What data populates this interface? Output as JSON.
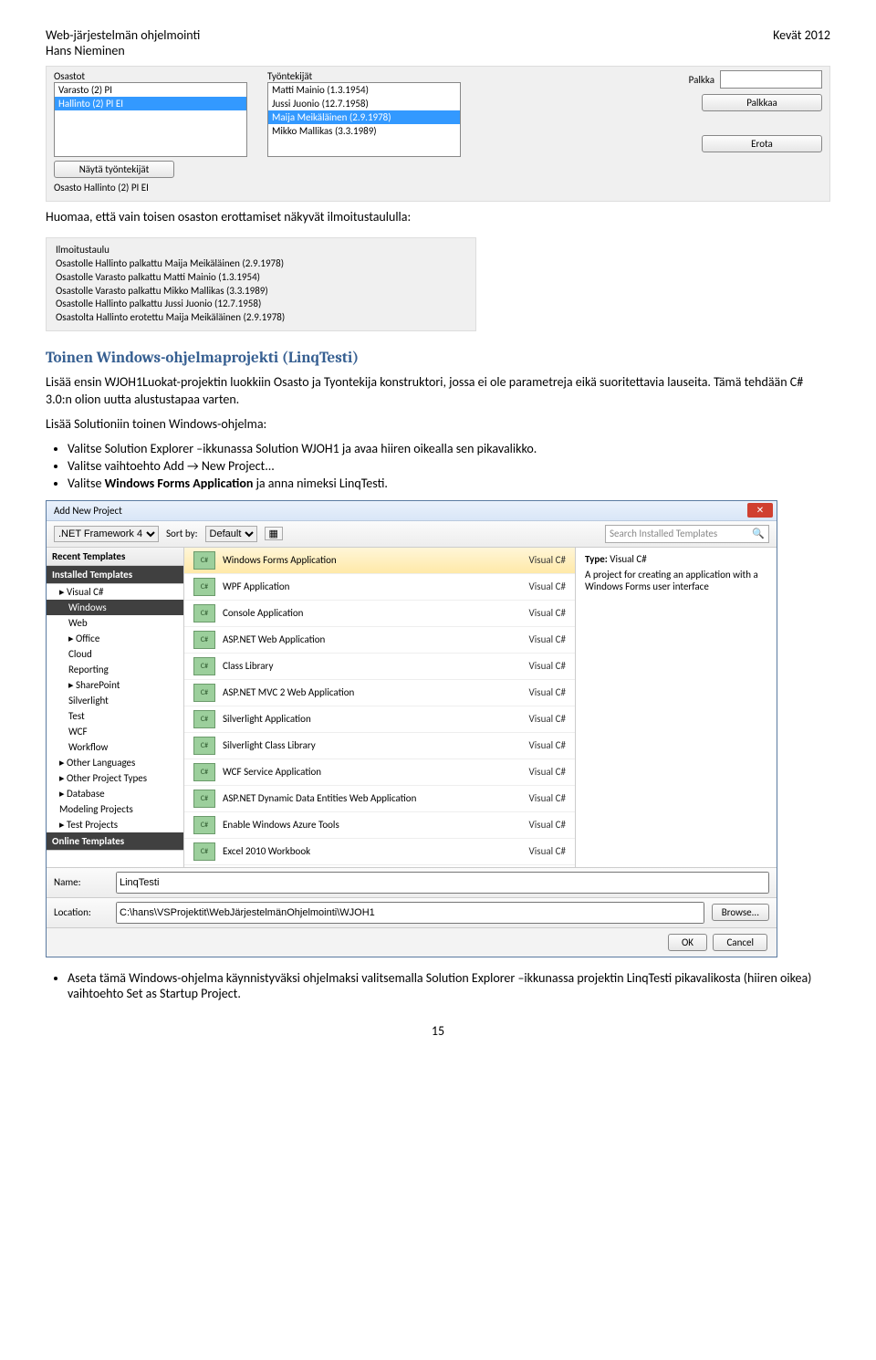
{
  "header": {
    "left1": "Web-järjestelmän ohjelmointi",
    "left2": "Hans Nieminen",
    "right": "Kevät 2012"
  },
  "formpanel": {
    "osastot_label": "Osastot",
    "osastot": [
      "Varasto (2) PI",
      "Hallinto (2) PI EI"
    ],
    "btn_nayta": "Näytä työntekijät",
    "summary": "Osasto Hallinto (2) PI EI",
    "tyontekijat_label": "Työntekijät",
    "tyontekijat": [
      "Matti Mainio (1.3.1954)",
      "Jussi Juonio (12.7.1958)",
      "Maija Meikäläinen (2.9.1978)",
      "Mikko Mallikas (3.3.1989)"
    ],
    "palkka_label": "Palkka",
    "btn_palkkaa": "Palkkaa",
    "btn_erota": "Erota"
  },
  "body_text1": "Huomaa, että vain toisen osaston erottamiset näkyvät ilmoitustaululla:",
  "ilmoituspanel": {
    "title": "Ilmoitustaulu",
    "rows": [
      "Osastolle Hallinto palkattu Maija Meikäläinen (2.9.1978)",
      "Osastolle Varasto palkattu Matti Mainio (1.3.1954)",
      "Osastolle Varasto palkattu Mikko Mallikas (3.3.1989)",
      "Osastolle Hallinto palkattu Jussi Juonio (12.7.1958)",
      "Osastolta Hallinto erotettu Maija Meikäläinen (2.9.1978)"
    ]
  },
  "h2": "Toinen Windows-ohjelmaprojekti (LinqTesti)",
  "p1": "Lisää ensin WJOH1Luokat-projektin luokkiin Osasto ja Tyontekija konstruktori, jossa ei ole parametreja eikä suoritettavia lauseita. Tämä tehdään C# 3.0:n olion uutta alustustapaa varten.",
  "p2": "Lisää Solutioniin toinen Windows-ohjelma:",
  "bullets_a": [
    "Valitse Solution Explorer –ikkunassa Solution WJOH1 ja avaa hiiren oikealla sen pikavalikko.",
    "Valitse vaihtoehto Add → New Project...",
    "Valitse <b>Windows Forms Application</b> ja anna nimeksi LinqTesti."
  ],
  "dialog": {
    "title": "Add New Project",
    "recent": "Recent Templates",
    "installed": "Installed Templates",
    "online": "Online Templates",
    "nav_root": "Visual C#",
    "nav_items": [
      "Windows",
      "Web",
      "Office",
      "Cloud",
      "Reporting",
      "SharePoint",
      "Silverlight",
      "Test",
      "WCF",
      "Workflow"
    ],
    "nav_after": [
      "Other Languages",
      "Other Project Types",
      "Database",
      "Modeling Projects",
      "Test Projects"
    ],
    "framework": ".NET Framework 4",
    "sortby": "Default",
    "search_placeholder": "Search Installed Templates",
    "lang": "Visual C#",
    "templates": [
      "Windows Forms Application",
      "WPF Application",
      "Console Application",
      "ASP.NET Web Application",
      "Class Library",
      "ASP.NET MVC 2 Web Application",
      "Silverlight Application",
      "Silverlight Class Library",
      "WCF Service Application",
      "ASP.NET Dynamic Data Entities Web Application",
      "Enable Windows Azure Tools",
      "Excel 2010 Workbook"
    ],
    "info_title": "Type:",
    "info_desc": "A project for creating an application with a Windows Forms user interface",
    "name_label": "Name:",
    "name_value": "LinqTesti",
    "loc_label": "Location:",
    "loc_value": "C:\\hans\\VSProjektit\\WebJärjestelmänOhjelmointi\\WJOH1",
    "browse": "Browse...",
    "ok": "OK",
    "cancel": "Cancel"
  },
  "bullet_b": "Aseta tämä Windows-ohjelma käynnistyväksi ohjelmaksi valitsemalla Solution Explorer –ikkunassa projektin LinqTesti pikavalikosta (hiiren oikea) vaihtoehto Set as Startup Project.",
  "page": "15"
}
